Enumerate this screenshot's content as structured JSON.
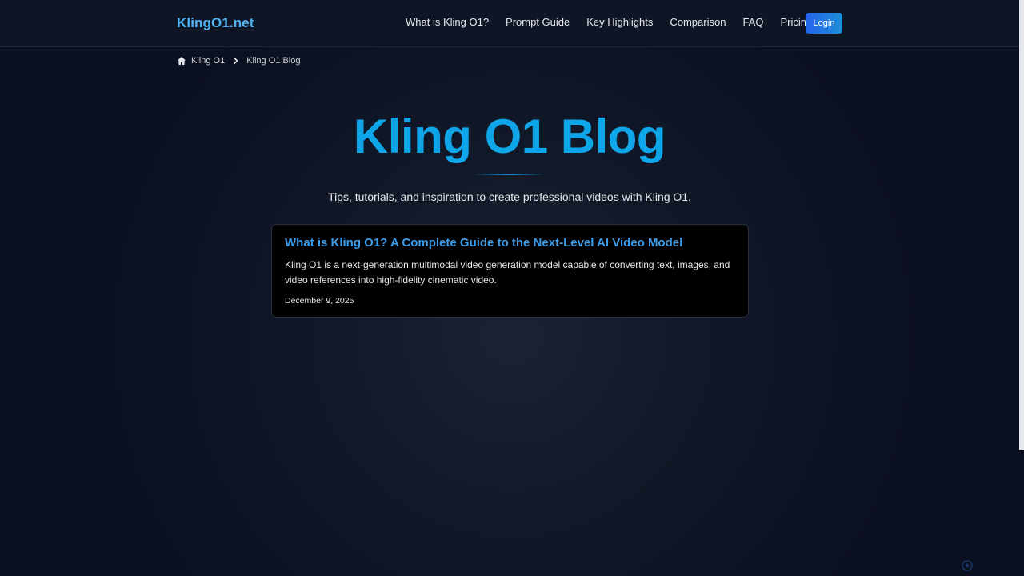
{
  "header": {
    "logo": "KlingO1.net",
    "nav": [
      "What is Kling O1?",
      "Prompt Guide",
      "Key Highlights",
      "Comparison",
      "FAQ",
      "Pricing"
    ],
    "login_label": "Login"
  },
  "breadcrumb": {
    "home_icon": "home-icon",
    "home_label": "Kling O1",
    "separator_icon": "chevron-right-icon",
    "current_label": "Kling O1 Blog"
  },
  "hero": {
    "title": "Kling O1 Blog",
    "subtitle": "Tips, tutorials, and inspiration to create professional videos with Kling O1."
  },
  "posts": [
    {
      "title": "What is Kling O1? A Complete Guide to the Next-Level AI Video Model",
      "excerpt": "Kling O1 is a next-generation multimodal video generation model capable of converting text, images, and video references into high-fidelity cinematic video.",
      "date": "December 9, 2025"
    }
  ],
  "colors": {
    "accent": "#0ea5e9",
    "logo": "#4fb3f0",
    "card_title": "#3b9be8",
    "login_bg": "#2563eb",
    "background": "#111827"
  }
}
